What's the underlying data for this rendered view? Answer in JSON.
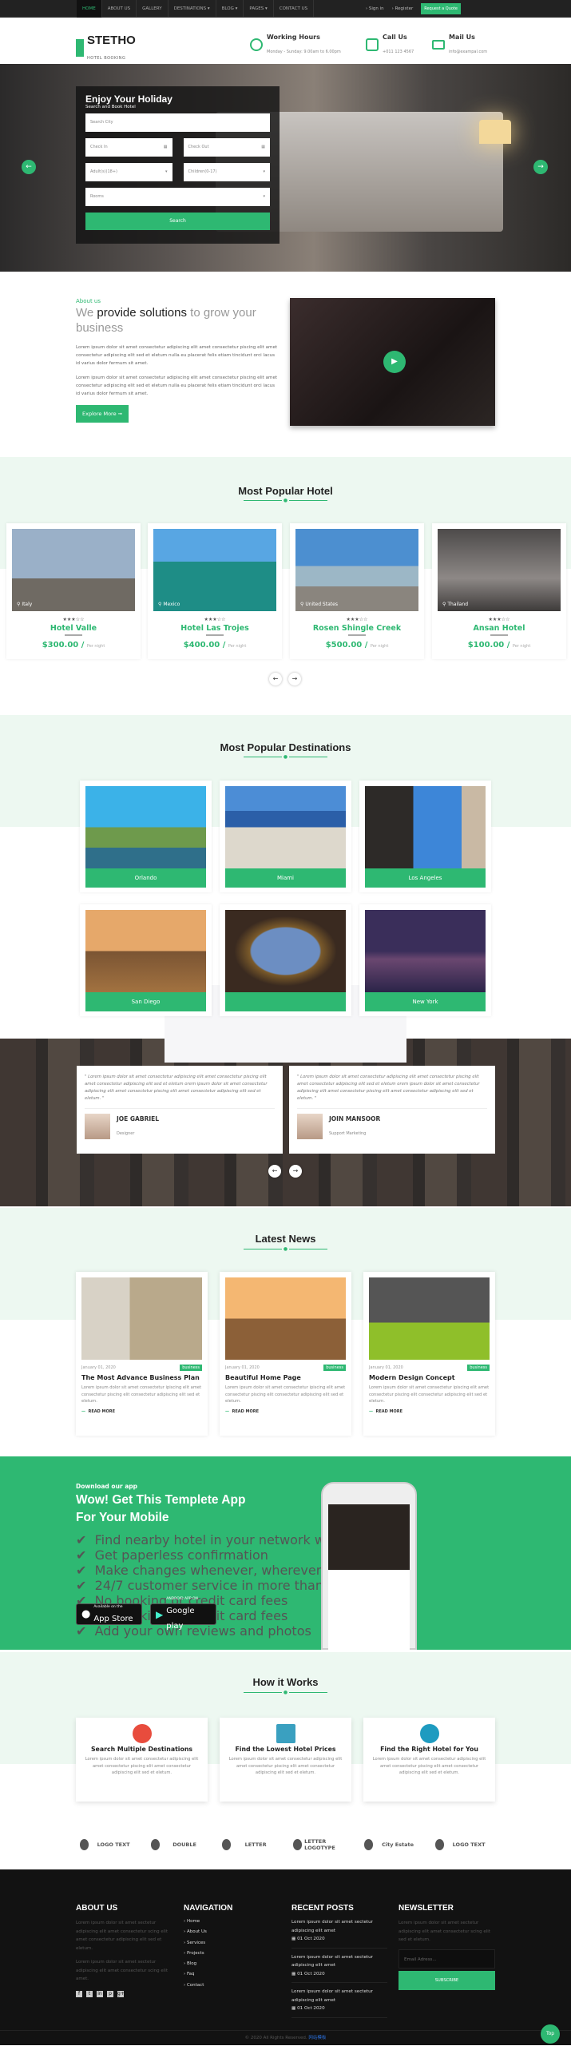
{
  "topnav": {
    "items": [
      "HOME",
      "ABOUT US",
      "GALLERY",
      "DESTINATIONS ▾",
      "BLOG ▾",
      "PAGES ▾",
      "CONTACT US"
    ],
    "signin": "› Sign in",
    "register": "› Register",
    "quote": "Request a Quote"
  },
  "header": {
    "brand": "STETHO",
    "tagline": "HOTEL BOOKING",
    "hours": {
      "title": "Working Hours",
      "text": "Monday - Sunday: 9.00am to 6.00pm"
    },
    "call": {
      "title": "Call Us",
      "text": "+011 123 4567"
    },
    "mail": {
      "title": "Mail Us",
      "text": "info@exampal.com"
    }
  },
  "hero": {
    "title": "Enjoy Your Holiday",
    "subtitle": "Search and Book Hotel",
    "city_placeholder": "Search City",
    "checkin": "Check In",
    "checkout": "Check Out",
    "adults": "Adult(s)(18+)",
    "children": "Children(0-17)",
    "rooms": "Rooms",
    "search": "Search",
    "prev": "←",
    "next": "→"
  },
  "about": {
    "kicker": "About us",
    "h_pre": "We ",
    "h_bold": "provide solutions",
    "h_post": " to grow your business",
    "p1": "Lorem ipsum dolor sit amet consectetur adipiscing elit amet consectetur piscing elit amet consectetur adipiscing elit sed et eletum nulla eu placerat felis etiam tincidunt orci lacus id varius dolor fermum sit amet.",
    "p2": "Lorem ipsum dolor sit amet consectetur adipiscing elit amet consectetur piscing elit amet consectetur adipiscing elit sed et eletum nulla eu placerat felis etiam tincidunt orci lacus id varius dolor fermum sit amet.",
    "button": "Explore More  ➞"
  },
  "hotels": {
    "title": "Most Popular Hotel",
    "per": "Per night",
    "stars": "★★★☆☆",
    "items": [
      {
        "name": "Hotel Valle",
        "location": "Italy",
        "price": "$300.00 /",
        "rating": 3
      },
      {
        "name": "Hotel Las Trojes",
        "location": "Mexico",
        "price": "$400.00 /",
        "rating": 3
      },
      {
        "name": "Rosen Shingle Creek",
        "location": "United States",
        "price": "$500.00 /",
        "rating": 3
      },
      {
        "name": "Ansan Hotel",
        "location": "Thailand",
        "price": "$100.00 /",
        "rating": 3
      }
    ],
    "prev": "←",
    "next": "→"
  },
  "destinations": {
    "title": "Most Popular Destinations",
    "items": [
      "Orlando",
      "Miami",
      "Los Angeles",
      "San Diego",
      "",
      "New York"
    ]
  },
  "testimonials": {
    "items": [
      {
        "quote": "\" Lorem ipsum dolor sit amet consectetur adipiscing elit amet consectetur piscing elit amet consectetur adipiscing elit sed et eletum orem ipsum dolor sit amet consectetur adipiscing elit amet consectetur piscing elit amet consectetur adipiscing elit sed et eletum. \"",
        "name": "JOE GABRIEL",
        "role": "Designer"
      },
      {
        "quote": "\" Lorem ipsum dolor sit amet consectetur adipiscing elit amet consectetur piscing elit amet consectetur adipiscing elit sed et eletum orem ipsum dolor sit amet consectetur adipiscing elit amet consectetur piscing elit amet consectetur adipiscing elit sed et eletum. \"",
        "name": "JOIN MANSOOR",
        "role": "Support Marketing"
      }
    ],
    "prev": "←",
    "next": "→"
  },
  "news": {
    "title": "Latest News",
    "read_more": "READ MORE",
    "items": [
      {
        "date": "January 01, 2020",
        "tag": "business",
        "title": "The Most Advance Business Plan",
        "text": "Lorem ipsum dolor sit amet consectetur ipiscing elit amet consectetur piscing elit consectetur adipiscing elit sed et eletum."
      },
      {
        "date": "January 01, 2020",
        "tag": "business",
        "title": "Beautiful Home Page",
        "text": "Lorem ipsum dolor sit amet consectetur ipiscing elit amet consectetur piscing elit consectetur adipiscing elit sed et eletum."
      },
      {
        "date": "January 01, 2020",
        "tag": "business",
        "title": "Modern Design Concept",
        "text": "Lorem ipsum dolor sit amet consectetur ipiscing elit amet consectetur piscing elit consectetur adipiscing elit sed et eletum."
      }
    ]
  },
  "app": {
    "kicker": "Download our app",
    "title": "Wow! Get This Templete App For Your Mobile",
    "features": [
      "Find nearby hotel in your network with templete",
      "Get paperless confirmation",
      "Make changes whenever, wherever",
      "24/7 customer service in more than 40 languages",
      "No booking or credit card fees",
      "No booking or credit card fees",
      "Add your own reviews and photos"
    ],
    "appstore_small": "Available on the",
    "appstore": "App Store",
    "google_small": "ANDROID APP ON",
    "google": "Google play"
  },
  "how": {
    "title": "How it Works",
    "items": [
      {
        "title": "Search Multiple Destinations",
        "text": "Lorem ipsum dolor sit amet consectetur adipiscing elit amet consectetur piscing elit amet consectetur adipiscing elit sed et eletum."
      },
      {
        "title": "Find the Lowest Hotel Prices",
        "text": "Lorem ipsum dolor sit amet consectetur adipiscing elit amet consectetur piscing elit amet consectetur adipiscing elit sed et eletum."
      },
      {
        "title": "Find the Right Hotel for You",
        "text": "Lorem ipsum dolor sit amet consectetur adipiscing elit amet consectetur piscing elit amet consectetur adipiscing elit sed et eletum."
      }
    ]
  },
  "logos": [
    "LOGO TEXT",
    "DOUBLE",
    "LETTER",
    "LETTER LOGOTYPE",
    "City Estate",
    "LOGO TEXT"
  ],
  "footer": {
    "about_title": "ABOUT US",
    "about_p1": "Lorem ipsum dolor sit amet sectetur adipiscing elit amet consectetur scing elit amet consectetur adipiscing elit sed et eletum.",
    "about_p2": "Lorem ipsum dolor sit amet sectetur adipiscing elit amet consectetur scing elit amet.",
    "social": [
      "f",
      "t",
      "in",
      "p",
      "g+"
    ],
    "nav_title": "NAVIGATION",
    "nav": [
      "Home",
      "About Us",
      "Services",
      "Projects",
      "Blog",
      "Faq",
      "Contact"
    ],
    "posts_title": "RECENT POSTS",
    "posts": [
      {
        "title": "Lorem ipsum dolor sit amet sectetur adipiscing elit amet",
        "date": "01 Oct 2020"
      },
      {
        "title": "Lorem ipsum dolor sit amet sectetur adipiscing elit amet",
        "date": "01 Oct 2020"
      },
      {
        "title": "Lorem ipsum dolor sit amet sectetur adipiscing elit amet",
        "date": "01 Oct 2020"
      }
    ],
    "news_title": "NEWSLETTER",
    "news_text": "Lorem ipsum dolor sit amet sectetur adipiscing elit amet consectetur scing elit sed et eletum.",
    "email_placeholder": "Email Adress...",
    "subscribe": "SUBSCRIBE",
    "copyright": "© 2020 All Rights Reserved.",
    "copyright_link": "网站模板",
    "top": "Top"
  },
  "colors": {
    "accent": "#2eb872",
    "dark": "#121212"
  }
}
